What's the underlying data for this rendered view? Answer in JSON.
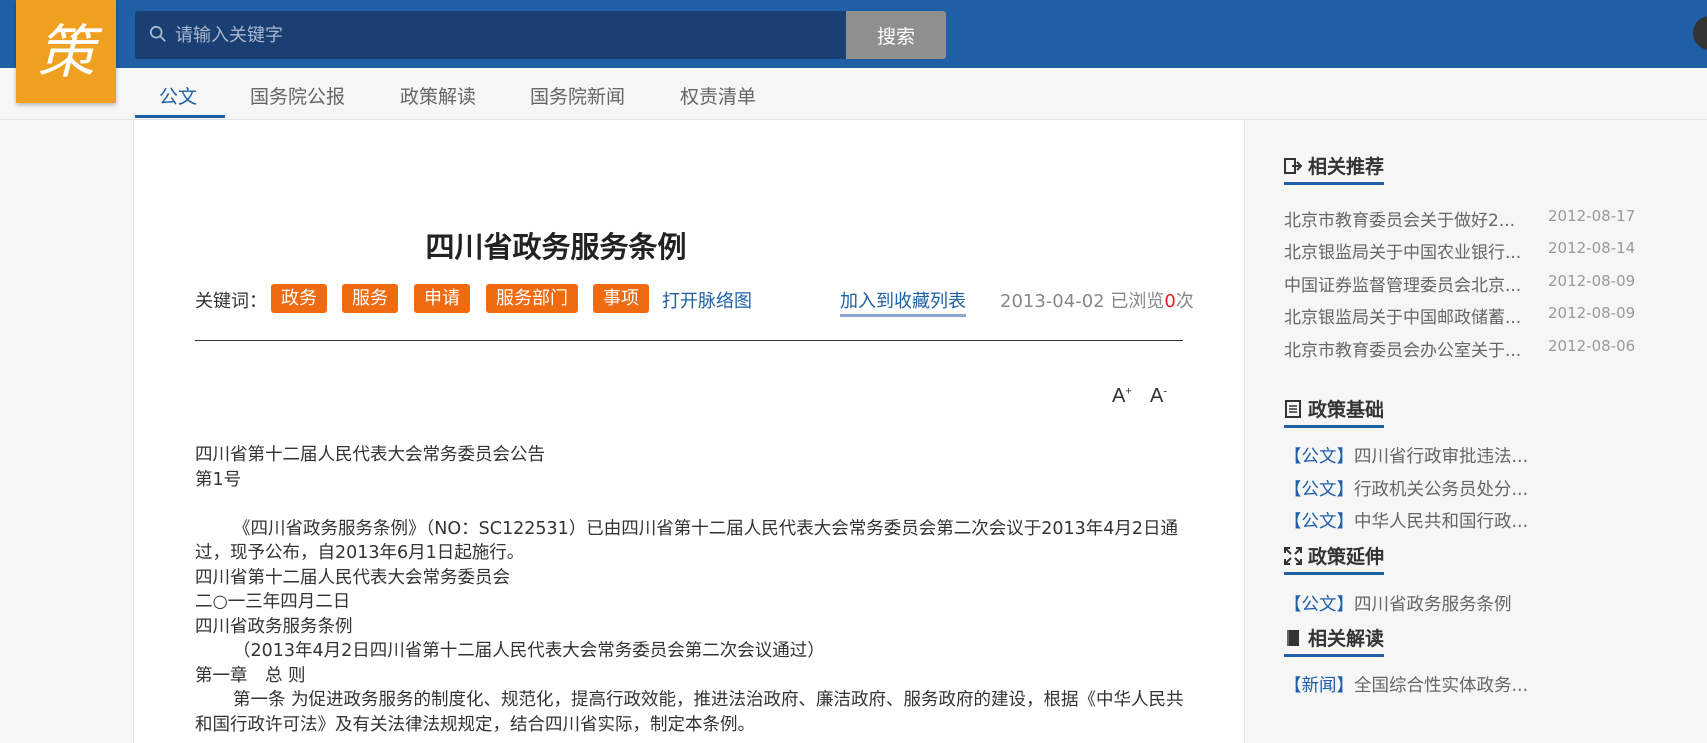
{
  "header": {
    "logo_char": "策",
    "search_placeholder": "请输入关键字",
    "search_button": "搜索"
  },
  "nav": {
    "tabs": [
      "公文",
      "国务院公报",
      "政策解读",
      "国务院新闻",
      "权责清单"
    ],
    "active": "公文"
  },
  "article": {
    "title": "四川省政务服务条例",
    "keywords_label": "关键词：",
    "keywords": [
      "政务",
      "服务",
      "申请",
      "服务部门",
      "事项"
    ],
    "open_graph_link": "打开脉络图",
    "add_favorite": "加入到收藏列表",
    "date": "2013-04-02",
    "views_prefix": "已浏览",
    "views_count": "0",
    "views_suffix": "次",
    "font_increase": "A+",
    "font_decrease": "A-",
    "body": [
      "四川省第十二届人民代表大会常务委员会公告",
      "第1号",
      "",
      "《四川省政务服务条例》（NO：SC122531）已由四川省第十二届人民代表大会常务委员会第二次会议于2013年4月2日通",
      "过，现予公布，自2013年6月1日起施行。",
      "四川省第十二届人民代表大会常务委员会",
      "二○一三年四月二日",
      "四川省政务服务条例",
      "（2013年4月2日四川省第十二届人民代表大会常务委员会第二次会议通过）",
      "第一章　总 则",
      "第一条 为促进政务服务的制度化、规范化，提高行政效能，推进法治政府、廉洁政府、服务政府的建设，根据《中华人民共",
      "和国行政许可法》及有关法律法规规定，结合四川省实际，制定本条例。"
    ]
  },
  "sidebar": {
    "recommend_title": "相关推荐",
    "recommend": [
      {
        "title": "北京市教育委员会关于做好2...",
        "date": "2012-08-17"
      },
      {
        "title": "北京银监局关于中国农业银行...",
        "date": "2012-08-14"
      },
      {
        "title": "中国证券监督管理委员会北京...",
        "date": "2012-08-09"
      },
      {
        "title": "北京银监局关于中国邮政储蓄...",
        "date": "2012-08-09"
      },
      {
        "title": "北京市教育委员会办公室关于...",
        "date": "2012-08-06"
      }
    ],
    "basis_title": "政策基础",
    "basis": [
      {
        "tag": "【公文】",
        "title": "四川省行政审批违法..."
      },
      {
        "tag": "【公文】",
        "title": "行政机关公务员处分..."
      },
      {
        "tag": "【公文】",
        "title": "中华人民共和国行政..."
      }
    ],
    "extension_title": "政策延伸",
    "extension": [
      {
        "tag": "【公文】",
        "title": "四川省政务服务条例"
      }
    ],
    "interpret_title": "相关解读",
    "interpret": [
      {
        "tag": "【新闻】",
        "title": "全国综合性实体政务..."
      }
    ]
  }
}
